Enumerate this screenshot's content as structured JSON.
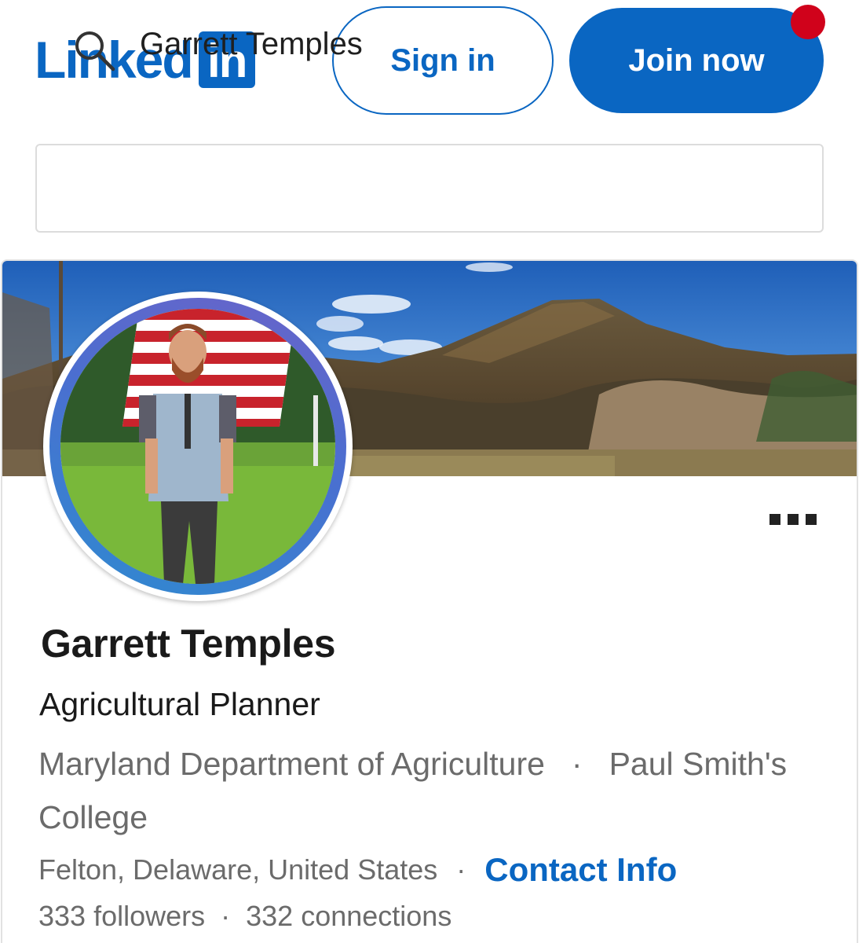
{
  "header": {
    "logo_word": "Linked",
    "logo_box": "in",
    "sign_in_label": "Sign in",
    "join_now_label": "Join now",
    "notification_dot_color": "#d0021b",
    "brand_color": "#0a66c2"
  },
  "search": {
    "value": "Garrett Temples",
    "icon": "search-icon"
  },
  "profile": {
    "name": "Garrett Temples",
    "headline": "Agricultural Planner",
    "company": "Maryland Department of Agriculture",
    "separator": "·",
    "school": "Paul Smith's College",
    "location": "Felton, Delaware, United States",
    "contact_info_label": "Contact Info",
    "followers": "333 followers",
    "connections": "332 connections",
    "more_menu_icon": "more-options-icon"
  }
}
